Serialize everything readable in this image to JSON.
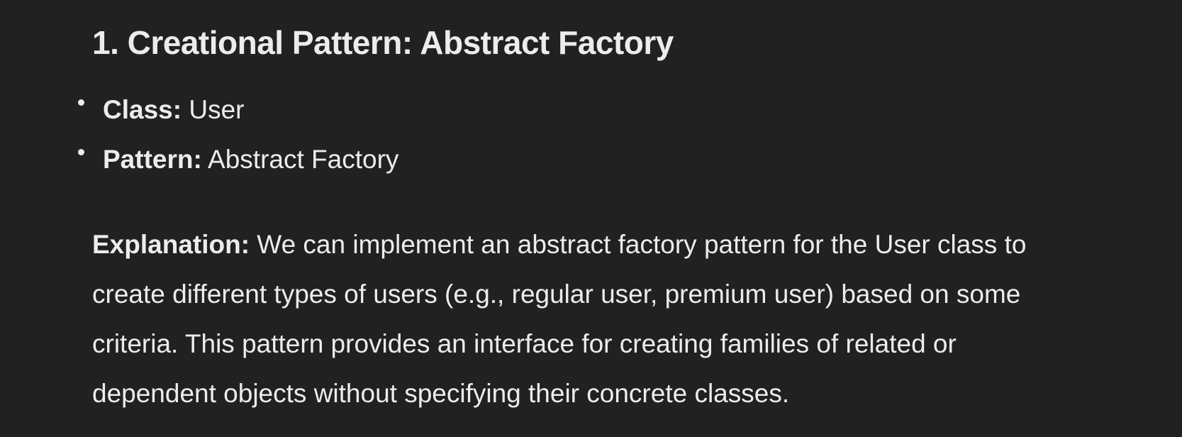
{
  "section": {
    "heading": "1. Creational Pattern: Abstract Factory",
    "bullets": [
      {
        "term": "Class:",
        "value": " User"
      },
      {
        "term": "Pattern:",
        "value": " Abstract Factory"
      }
    ],
    "explanation": {
      "term": "Explanation:",
      "lines": [
        " We can implement an abstract factory pattern for the User class to",
        "create different types of users (e.g., regular user, premium user) based on some",
        "criteria. This pattern provides an interface for creating families of related or",
        "dependent objects without specifying their concrete classes."
      ]
    }
  },
  "colors": {
    "background": "#212121",
    "text": "#ececec"
  }
}
